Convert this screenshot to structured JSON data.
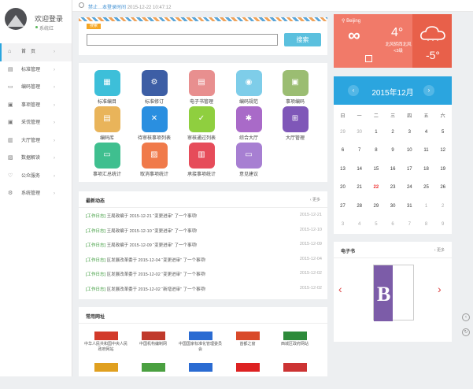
{
  "profile": {
    "welcome": "欢迎登录",
    "status": "系统红"
  },
  "topbar": {
    "prefix": "禁止…本登录时间",
    "time": "2015-12-22 10:47:12"
  },
  "nav": [
    {
      "label": "首　页",
      "icon": "home-icon"
    },
    {
      "label": "标准管理",
      "icon": "book-icon"
    },
    {
      "label": "编码管理",
      "icon": "monitor-icon"
    },
    {
      "label": "事项管理",
      "icon": "folder-icon"
    },
    {
      "label": "采伐管理",
      "icon": "folder-icon"
    },
    {
      "label": "大厅管理",
      "icon": "building-icon"
    },
    {
      "label": "数据解读",
      "icon": "chart-icon"
    },
    {
      "label": "公众服务",
      "icon": "heart-icon"
    },
    {
      "label": "系统管理",
      "icon": "settings-icon"
    }
  ],
  "search": {
    "tag": "搜索",
    "placeholder": "",
    "button": "搜索"
  },
  "apps": [
    {
      "label": "标准编目",
      "color": "#3dbfd9",
      "glyph": "▦"
    },
    {
      "label": "标准修订",
      "color": "#3d5ea5",
      "glyph": "⚙"
    },
    {
      "label": "电子书管理",
      "color": "#e88f8f",
      "glyph": "▤"
    },
    {
      "label": "编码规范",
      "color": "#7ecde9",
      "glyph": "◉"
    },
    {
      "label": "事项编码",
      "color": "#9bbd72",
      "glyph": "▣"
    },
    {
      "label": "编码库",
      "color": "#e9b45a",
      "glyph": "▤"
    },
    {
      "label": "待审核事项列表",
      "color": "#2a8fe0",
      "glyph": "✕"
    },
    {
      "label": "审核通过列表",
      "color": "#8fcf3f",
      "glyph": "✓"
    },
    {
      "label": "综合大厅",
      "color": "#a96ac8",
      "glyph": "✱"
    },
    {
      "label": "大厅管理",
      "color": "#7f57b8",
      "glyph": "⊞"
    },
    {
      "label": "事项汇总统计",
      "color": "#3fbf8f",
      "glyph": "▭"
    },
    {
      "label": "取消事项统计",
      "color": "#f07a4a",
      "glyph": "▨"
    },
    {
      "label": "承接事项统计",
      "color": "#e64c5a",
      "glyph": "▥"
    },
    {
      "label": "意见建议",
      "color": "#a77fd2",
      "glyph": "▭"
    }
  ],
  "news": {
    "title": "最新动态",
    "more": "更多",
    "items": [
      {
        "tag": "[工作日志]",
        "text": "王局政编于 2015-12-21 “变更进审” 了一个事项!",
        "date": "2015-12-21"
      },
      {
        "tag": "[工作日志]",
        "text": "王局政编于 2015-12-10 “变更进审” 了一个事项!",
        "date": "2015-12-10"
      },
      {
        "tag": "[工作日志]",
        "text": "王局政编于 2015-12-09 “变更进审” 了一个事项!",
        "date": "2015-12-09"
      },
      {
        "tag": "[工作日志]",
        "text": "区发展改革委于 2015-12-04 “变更进审” 了一个事项!",
        "date": "2015-12-04"
      },
      {
        "tag": "[工作日志]",
        "text": "区发展改革委于 2015-12-02 “变更进审” 了一个事项!",
        "date": "2015-12-02"
      },
      {
        "tag": "[工作日志]",
        "text": "区发展改革委于 2015-12-02 “新增进审” 了一个事项!",
        "date": "2015-12-02"
      }
    ]
  },
  "sites": {
    "title": "常用网址",
    "items": [
      {
        "name": "中华人民共和国中央人民政府网站",
        "color": "#d23a2a"
      },
      {
        "name": "中国机构编制网",
        "color": "#c0392b"
      },
      {
        "name": "中国国家标准化管理委员会",
        "color": "#2a6bd2"
      },
      {
        "name": "首都之窗",
        "color": "#d94a2a"
      },
      {
        "name": "西城区政府网站",
        "color": "#2d8a3a"
      },
      {
        "name": "",
        "color": "#e0a020"
      },
      {
        "name": "",
        "color": "#4aa040"
      },
      {
        "name": "",
        "color": "#2a6bd2"
      },
      {
        "name": "",
        "color": "#d22"
      },
      {
        "name": "",
        "color": "#c33"
      }
    ]
  },
  "weather": {
    "city": "Beijing",
    "temp_now": "4°",
    "condition": "北风转西北风",
    "wind": "<3级",
    "temp_low": "-5°"
  },
  "calendar": {
    "month": "2015年12月",
    "weekdays": [
      "日",
      "一",
      "二",
      "三",
      "四",
      "五",
      "六"
    ],
    "weeks": [
      [
        {
          "d": "29",
          "o": true
        },
        {
          "d": "30",
          "o": true
        },
        {
          "d": "1"
        },
        {
          "d": "2"
        },
        {
          "d": "3"
        },
        {
          "d": "4"
        },
        {
          "d": "5"
        }
      ],
      [
        {
          "d": "6"
        },
        {
          "d": "7"
        },
        {
          "d": "8"
        },
        {
          "d": "9"
        },
        {
          "d": "10"
        },
        {
          "d": "11"
        },
        {
          "d": "12"
        }
      ],
      [
        {
          "d": "13"
        },
        {
          "d": "14"
        },
        {
          "d": "15"
        },
        {
          "d": "16"
        },
        {
          "d": "17"
        },
        {
          "d": "18"
        },
        {
          "d": "19"
        }
      ],
      [
        {
          "d": "20"
        },
        {
          "d": "21"
        },
        {
          "d": "22",
          "today": true
        },
        {
          "d": "23"
        },
        {
          "d": "24"
        },
        {
          "d": "25"
        },
        {
          "d": "26"
        }
      ],
      [
        {
          "d": "27"
        },
        {
          "d": "28"
        },
        {
          "d": "29"
        },
        {
          "d": "30"
        },
        {
          "d": "31"
        },
        {
          "d": "1",
          "o": true
        },
        {
          "d": "2",
          "o": true
        }
      ],
      [
        {
          "d": "3",
          "o": true
        },
        {
          "d": "4",
          "o": true
        },
        {
          "d": "5",
          "o": true
        },
        {
          "d": "6",
          "o": true
        },
        {
          "d": "7",
          "o": true
        },
        {
          "d": "8",
          "o": true
        },
        {
          "d": "9",
          "o": true
        }
      ]
    ]
  },
  "ebook": {
    "title": "电子书",
    "more": "更多",
    "cover_letter": "B"
  },
  "colors": {
    "accent": "#2aa6df",
    "search_button": "#5bc0de",
    "weather": "#f17a69"
  }
}
